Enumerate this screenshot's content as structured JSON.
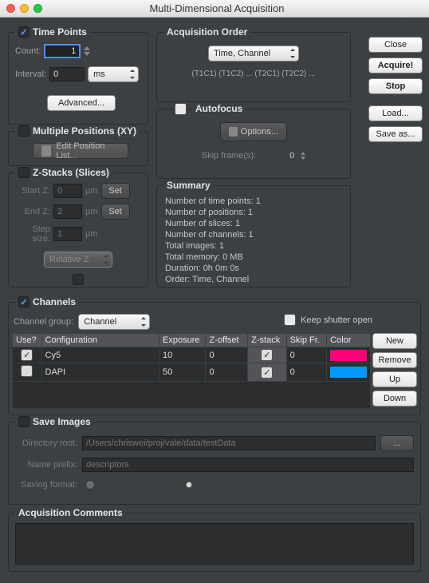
{
  "window": {
    "title": "Multi-Dimensional Acquisition"
  },
  "sideButtons": {
    "close": "Close",
    "acquire": "Acquire!",
    "stop": "Stop",
    "load": "Load...",
    "saveAs": "Save as..."
  },
  "timePoints": {
    "title": "Time Points",
    "checked": true,
    "countLabel": "Count:",
    "count": "1",
    "intervalLabel": "Interval:",
    "interval": "0",
    "unit": "ms",
    "advanced": "Advanced..."
  },
  "positions": {
    "title": "Multiple Positions (XY)",
    "checked": false,
    "edit": "Edit Position List..."
  },
  "zstacks": {
    "title": "Z-Stacks (Slices)",
    "checked": false,
    "startLabel": "Start Z:",
    "start": "0",
    "unit": "µm",
    "setBtn": "Set",
    "endLabel": "End Z:",
    "end": "2",
    "stepLabel": "Step size:",
    "step": "1",
    "mode": "Relative Z"
  },
  "acqOrder": {
    "title": "Acquisition Order",
    "value": "Time, Channel",
    "pattern": "(T1C1) (T1C2) ... (T2C1) (T2C2) ..."
  },
  "autofocus": {
    "title": "Autofocus",
    "checked": false,
    "options": "Options...",
    "skipLabel": "Skip frame(s):",
    "skip": "0"
  },
  "summary": {
    "title": "Summary",
    "lines": [
      "Number of time points: 1",
      "Number of positions: 1",
      "Number of slices: 1",
      "Number of channels: 1",
      "Total images: 1",
      "Total memory: 0 MB",
      "Duration: 0h 0m 0s",
      "Order: Time, Channel"
    ]
  },
  "channels": {
    "title": "Channels",
    "checked": true,
    "groupLabel": "Channel group:",
    "group": "Channel",
    "keepShutter": "Keep shutter open",
    "keepShutterChecked": false,
    "headers": [
      "Use?",
      "Configuration",
      "Exposure",
      "Z-offset",
      "Z-stack",
      "Skip Fr.",
      "Color"
    ],
    "rows": [
      {
        "use": true,
        "config": "Cy5",
        "exposure": "10",
        "zoffset": "0",
        "zstack": true,
        "skip": "0",
        "color": "#ff0078"
      },
      {
        "use": false,
        "config": "DAPI",
        "exposure": "50",
        "zoffset": "0",
        "zstack": true,
        "skip": "0",
        "color": "#0099ff"
      }
    ],
    "btns": {
      "new": "New",
      "remove": "Remove",
      "up": "Up",
      "down": "Down"
    }
  },
  "saveImages": {
    "title": "Save Images",
    "checked": false,
    "dirLabel": "Directory root:",
    "dir": "/Users/chriswei/proj/vale/data/testData",
    "browse": "...",
    "prefixLabel": "Name prefix:",
    "prefix": "descriptors",
    "formatLabel": "Saving format:"
  },
  "comments": {
    "title": "Acquisition Comments",
    "text": ""
  }
}
